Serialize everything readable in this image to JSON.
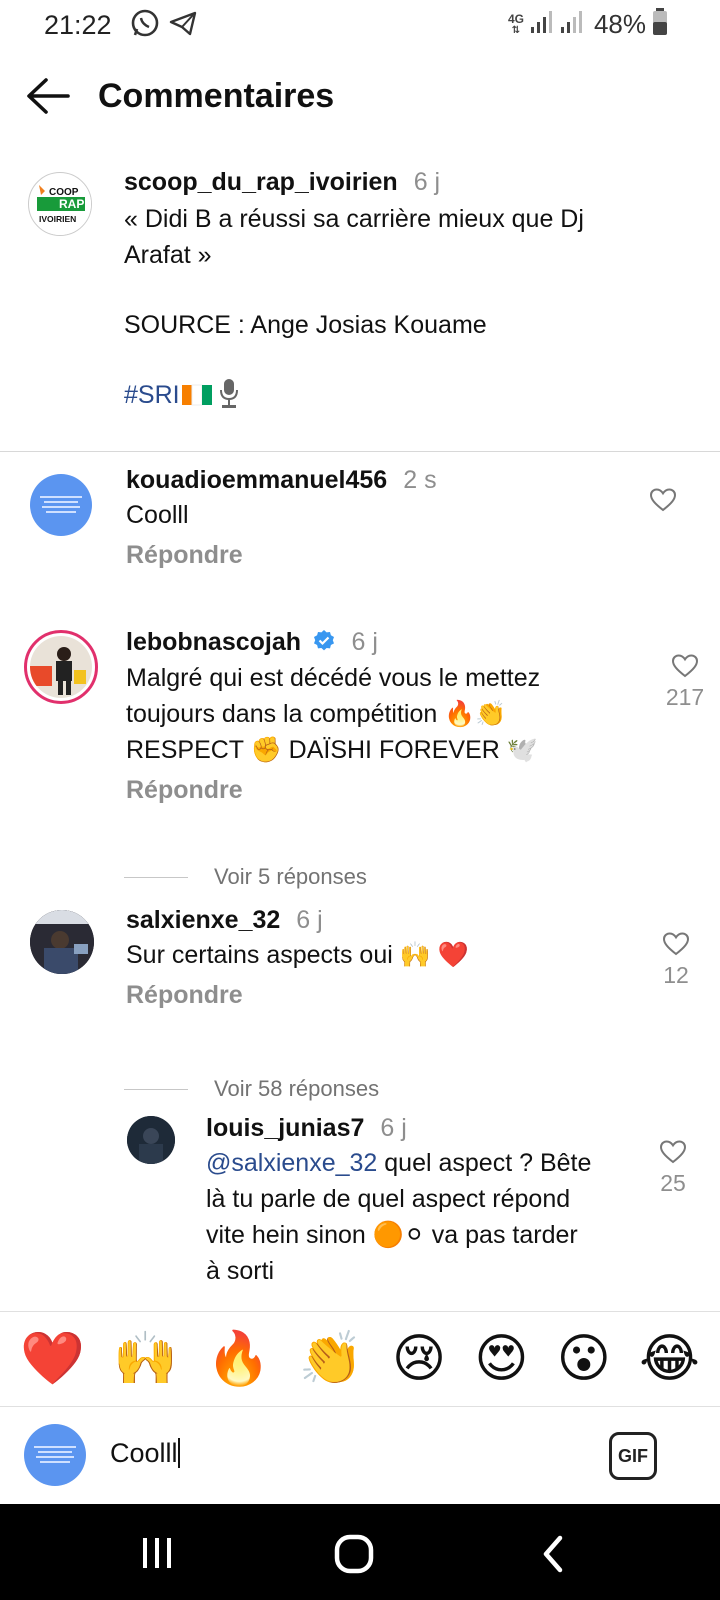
{
  "status_bar": {
    "time": "21:22",
    "network": "4G",
    "battery": "48%"
  },
  "header": {
    "title": "Commentaires"
  },
  "post": {
    "username": "scoop_du_rap_ivoirien",
    "time": "6 j",
    "lines": [
      "« Didi B a réussi sa carrière mieux que Dj",
      "Arafat »"
    ],
    "source": "SOURCE : Ange Josias Kouame",
    "hashtag": "#SRI",
    "avatar_text": [
      "COOP",
      "RAP",
      "IVOIRIEN"
    ]
  },
  "comments": [
    {
      "username": "kouadioemmanuel456",
      "time": "2 s",
      "lines": [
        "Coolll"
      ],
      "reply": "Répondre",
      "likes": ""
    },
    {
      "username": "lebobnascojah",
      "time": "6 j",
      "verified": true,
      "lines": [
        "Malgré qui est décédé vous le mettez",
        "toujours dans la compétition 🔥👏",
        "RESPECT ✊ DAÏSHI FOREVER 🕊️"
      ],
      "reply": "Répondre",
      "likes": "217",
      "view_replies": "Voir 5 réponses"
    },
    {
      "username": "salxienxe_32",
      "time": "6 j",
      "lines": [
        "Sur certains aspects oui 🙌 ❤️"
      ],
      "reply": "Répondre",
      "likes": "12",
      "view_replies": "Voir 58 réponses"
    },
    {
      "username": "louis_junias7",
      "time": "6 j",
      "mention": "@salxienxe_32",
      "lines": [
        " quel aspect ? Bête",
        "là tu parle de quel aspect répond",
        "vite hein sinon 🟠⚪ va pas tarder",
        "à sorti"
      ],
      "likes": "25"
    }
  ],
  "emoji_bar": [
    "❤️",
    "🙌",
    "🔥",
    "👏",
    "😢",
    "😍",
    "😮",
    "😂"
  ],
  "composer": {
    "value": "Coolll",
    "gif_label": "GIF"
  },
  "colors": {
    "accent_blue": "#3897f0",
    "link_blue": "#2a4b8d",
    "muted": "#8e8e8e",
    "avatar_blue": "#5b95f0"
  }
}
